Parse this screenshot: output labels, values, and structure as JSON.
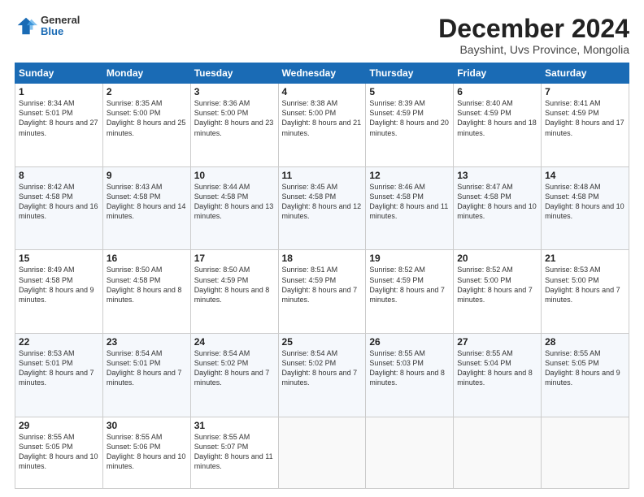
{
  "logo": {
    "general": "General",
    "blue": "Blue"
  },
  "title": "December 2024",
  "location": "Bayshint, Uvs Province, Mongolia",
  "days_of_week": [
    "Sunday",
    "Monday",
    "Tuesday",
    "Wednesday",
    "Thursday",
    "Friday",
    "Saturday"
  ],
  "weeks": [
    [
      {
        "day": "1",
        "sunrise": "8:34 AM",
        "sunset": "5:01 PM",
        "daylight": "8 hours and 27 minutes."
      },
      {
        "day": "2",
        "sunrise": "8:35 AM",
        "sunset": "5:00 PM",
        "daylight": "8 hours and 25 minutes."
      },
      {
        "day": "3",
        "sunrise": "8:36 AM",
        "sunset": "5:00 PM",
        "daylight": "8 hours and 23 minutes."
      },
      {
        "day": "4",
        "sunrise": "8:38 AM",
        "sunset": "5:00 PM",
        "daylight": "8 hours and 21 minutes."
      },
      {
        "day": "5",
        "sunrise": "8:39 AM",
        "sunset": "4:59 PM",
        "daylight": "8 hours and 20 minutes."
      },
      {
        "day": "6",
        "sunrise": "8:40 AM",
        "sunset": "4:59 PM",
        "daylight": "8 hours and 18 minutes."
      },
      {
        "day": "7",
        "sunrise": "8:41 AM",
        "sunset": "4:59 PM",
        "daylight": "8 hours and 17 minutes."
      }
    ],
    [
      {
        "day": "8",
        "sunrise": "8:42 AM",
        "sunset": "4:58 PM",
        "daylight": "8 hours and 16 minutes."
      },
      {
        "day": "9",
        "sunrise": "8:43 AM",
        "sunset": "4:58 PM",
        "daylight": "8 hours and 14 minutes."
      },
      {
        "day": "10",
        "sunrise": "8:44 AM",
        "sunset": "4:58 PM",
        "daylight": "8 hours and 13 minutes."
      },
      {
        "day": "11",
        "sunrise": "8:45 AM",
        "sunset": "4:58 PM",
        "daylight": "8 hours and 12 minutes."
      },
      {
        "day": "12",
        "sunrise": "8:46 AM",
        "sunset": "4:58 PM",
        "daylight": "8 hours and 11 minutes."
      },
      {
        "day": "13",
        "sunrise": "8:47 AM",
        "sunset": "4:58 PM",
        "daylight": "8 hours and 10 minutes."
      },
      {
        "day": "14",
        "sunrise": "8:48 AM",
        "sunset": "4:58 PM",
        "daylight": "8 hours and 10 minutes."
      }
    ],
    [
      {
        "day": "15",
        "sunrise": "8:49 AM",
        "sunset": "4:58 PM",
        "daylight": "8 hours and 9 minutes."
      },
      {
        "day": "16",
        "sunrise": "8:50 AM",
        "sunset": "4:58 PM",
        "daylight": "8 hours and 8 minutes."
      },
      {
        "day": "17",
        "sunrise": "8:50 AM",
        "sunset": "4:59 PM",
        "daylight": "8 hours and 8 minutes."
      },
      {
        "day": "18",
        "sunrise": "8:51 AM",
        "sunset": "4:59 PM",
        "daylight": "8 hours and 7 minutes."
      },
      {
        "day": "19",
        "sunrise": "8:52 AM",
        "sunset": "4:59 PM",
        "daylight": "8 hours and 7 minutes."
      },
      {
        "day": "20",
        "sunrise": "8:52 AM",
        "sunset": "5:00 PM",
        "daylight": "8 hours and 7 minutes."
      },
      {
        "day": "21",
        "sunrise": "8:53 AM",
        "sunset": "5:00 PM",
        "daylight": "8 hours and 7 minutes."
      }
    ],
    [
      {
        "day": "22",
        "sunrise": "8:53 AM",
        "sunset": "5:01 PM",
        "daylight": "8 hours and 7 minutes."
      },
      {
        "day": "23",
        "sunrise": "8:54 AM",
        "sunset": "5:01 PM",
        "daylight": "8 hours and 7 minutes."
      },
      {
        "day": "24",
        "sunrise": "8:54 AM",
        "sunset": "5:02 PM",
        "daylight": "8 hours and 7 minutes."
      },
      {
        "day": "25",
        "sunrise": "8:54 AM",
        "sunset": "5:02 PM",
        "daylight": "8 hours and 7 minutes."
      },
      {
        "day": "26",
        "sunrise": "8:55 AM",
        "sunset": "5:03 PM",
        "daylight": "8 hours and 8 minutes."
      },
      {
        "day": "27",
        "sunrise": "8:55 AM",
        "sunset": "5:04 PM",
        "daylight": "8 hours and 8 minutes."
      },
      {
        "day": "28",
        "sunrise": "8:55 AM",
        "sunset": "5:05 PM",
        "daylight": "8 hours and 9 minutes."
      }
    ],
    [
      {
        "day": "29",
        "sunrise": "8:55 AM",
        "sunset": "5:05 PM",
        "daylight": "8 hours and 10 minutes."
      },
      {
        "day": "30",
        "sunrise": "8:55 AM",
        "sunset": "5:06 PM",
        "daylight": "8 hours and 10 minutes."
      },
      {
        "day": "31",
        "sunrise": "8:55 AM",
        "sunset": "5:07 PM",
        "daylight": "8 hours and 11 minutes."
      },
      null,
      null,
      null,
      null
    ]
  ],
  "labels": {
    "sunrise": "Sunrise:",
    "sunset": "Sunset:",
    "daylight": "Daylight:"
  }
}
